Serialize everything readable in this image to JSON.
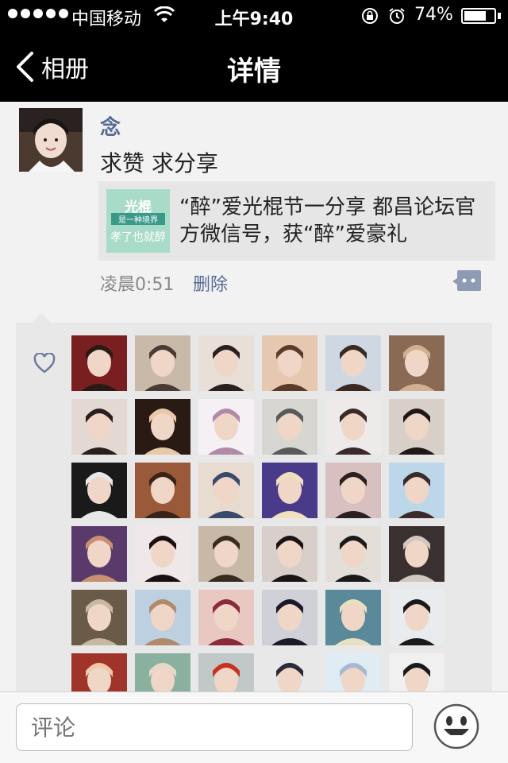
{
  "status_bar": {
    "carrier": "中国移动",
    "time": "上午9:40",
    "battery_pct": "74%",
    "battery_level": 0.74,
    "signal_dots": 5
  },
  "nav": {
    "back_label": "相册",
    "title": "详情"
  },
  "post": {
    "author": "念",
    "text": "求赞 求分享",
    "link": {
      "title": "“醉”爱光棍节一分享 都昌论坛官方微信号，获“醉”爱豪礼",
      "thumb_title": "光棍",
      "thumb_sub": "是一种境界",
      "thumb_line": "孝了也就醉"
    },
    "time": "凌晨0:51",
    "delete_label": "删除"
  },
  "likes": {
    "icon": "heart-icon",
    "avatars": [
      {
        "name": "liker-1",
        "bg": "#7a1f1f",
        "fg": "#2a1a14"
      },
      {
        "name": "liker-2",
        "bg": "#c9b9a8",
        "fg": "#4a3a34"
      },
      {
        "name": "liker-3",
        "bg": "#e8e0d8",
        "fg": "#2b2020"
      },
      {
        "name": "liker-4",
        "bg": "#e6c7b0",
        "fg": "#5b3a2a"
      },
      {
        "name": "liker-5",
        "bg": "#cfd8e2",
        "fg": "#3a2a22"
      },
      {
        "name": "liker-6",
        "bg": "#8a6a55",
        "fg": "#d0b090"
      },
      {
        "name": "liker-7",
        "bg": "#e4d8d2",
        "fg": "#2a1e1e"
      },
      {
        "name": "liker-8",
        "bg": "#2a1a14",
        "fg": "#e8c8a8"
      },
      {
        "name": "liker-9",
        "bg": "#f4f0f4",
        "fg": "#b08aa8"
      },
      {
        "name": "liker-10",
        "bg": "#d8d6d2",
        "fg": "#5a5a5a"
      },
      {
        "name": "liker-11",
        "bg": "#eeeaea",
        "fg": "#3a2a2a"
      },
      {
        "name": "liker-12",
        "bg": "#d8d0c8",
        "fg": "#201818"
      },
      {
        "name": "liker-13",
        "bg": "#1a1a1a",
        "fg": "#e8e8e8"
      },
      {
        "name": "liker-14",
        "bg": "#9a5a3a",
        "fg": "#3a2418"
      },
      {
        "name": "liker-15",
        "bg": "#e8dcd0",
        "fg": "#3a4a6a"
      },
      {
        "name": "liker-16",
        "bg": "#4a3a8a",
        "fg": "#f0e0c0"
      },
      {
        "name": "liker-17",
        "bg": "#d8c0c0",
        "fg": "#2a2020"
      },
      {
        "name": "liker-18",
        "bg": "#bcd6ea",
        "fg": "#3a2a2a"
      },
      {
        "name": "liker-19",
        "bg": "#5a3a6a",
        "fg": "#c89070"
      },
      {
        "name": "liker-20",
        "bg": "#f0e8e8",
        "fg": "#1a1010"
      },
      {
        "name": "liker-21",
        "bg": "#c8b8a8",
        "fg": "#3a2a20"
      },
      {
        "name": "liker-22",
        "bg": "#d8cfca",
        "fg": "#1a1414"
      },
      {
        "name": "liker-23",
        "bg": "#e4ded8",
        "fg": "#1a1a1a"
      },
      {
        "name": "liker-24",
        "bg": "#3a3030",
        "fg": "#d0c8c0"
      },
      {
        "name": "liker-25",
        "bg": "#6a5a48",
        "fg": "#c8b8a0"
      },
      {
        "name": "liker-26",
        "bg": "#bcd0e0",
        "fg": "#b08a6a"
      },
      {
        "name": "liker-27",
        "bg": "#e8c8c0",
        "fg": "#8a2a3a"
      },
      {
        "name": "liker-28",
        "bg": "#d0d0d8",
        "fg": "#1a1a2a"
      },
      {
        "name": "liker-29",
        "bg": "#5a8a9a",
        "fg": "#e8e0c0"
      },
      {
        "name": "liker-30",
        "bg": "#e8ecee",
        "fg": "#1a1a1a"
      },
      {
        "name": "liker-31",
        "bg": "#a0342a",
        "fg": "#f0c8a8"
      },
      {
        "name": "liker-32",
        "bg": "#8ab0a0",
        "fg": "#e8d8c8"
      },
      {
        "name": "liker-33",
        "bg": "#c0c8c8",
        "fg": "#c83020"
      },
      {
        "name": "liker-34",
        "bg": "#e8e8e8",
        "fg": "#2a2a3a"
      },
      {
        "name": "liker-35",
        "bg": "#e0ecf4",
        "fg": "#a8b8d0"
      },
      {
        "name": "liker-36",
        "bg": "#f0f0f0",
        "fg": "#1a1a1a"
      }
    ]
  },
  "bottom_bar": {
    "placeholder": "评论",
    "emoji_icon": "smiley-icon"
  },
  "colors": {
    "link_blue": "#576b95",
    "bar_black": "#000000",
    "background": "#f2f2f2",
    "likes_bg": "#e8e8e8"
  }
}
